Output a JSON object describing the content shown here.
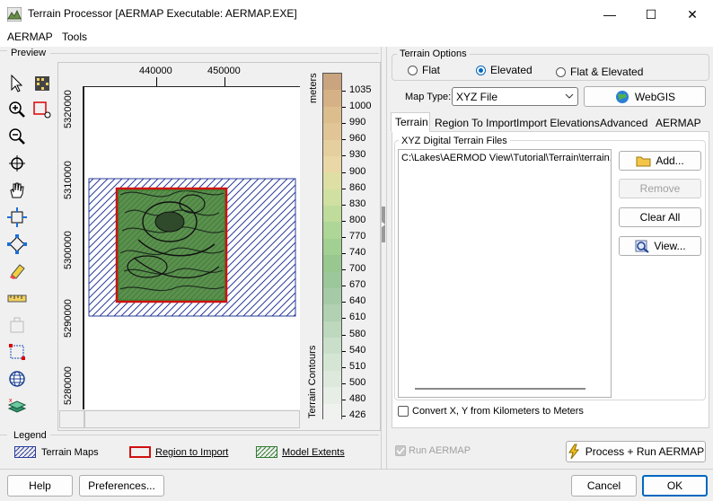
{
  "window": {
    "title": "Terrain Processor [AERMAP Executable: AERMAP.EXE]",
    "minimize_glyph": "—",
    "maximize_glyph": "☐",
    "close_glyph": "✕"
  },
  "menu": {
    "items": [
      "AERMAP",
      "Tools"
    ]
  },
  "preview": {
    "label": "Preview",
    "x_ticks": [
      "440000",
      "450000"
    ],
    "y_ticks": [
      "5320000",
      "5310000",
      "5300000",
      "5290000",
      "5280000"
    ],
    "colorbar_units": "meters",
    "colorbar_title": "Terrain Contours",
    "contour_levels": [
      "1035",
      "1000",
      "990",
      "960",
      "930",
      "900",
      "860",
      "830",
      "800",
      "770",
      "740",
      "700",
      "670",
      "640",
      "610",
      "580",
      "540",
      "510",
      "500",
      "480",
      "426"
    ],
    "contour_colors": [
      "#c9a47e",
      "#d6b186",
      "#dcbd8c",
      "#e2c596",
      "#e6cf9e",
      "#e9d7a6",
      "#dedfa2",
      "#d0e0a0",
      "#bfdc9b",
      "#aed696",
      "#a2d092",
      "#98c890",
      "#9cc79a",
      "#a5cba6",
      "#b1d1b2",
      "#bdd8bd",
      "#c9dfc9",
      "#d4e6d3",
      "#dee9dd",
      "#e7eee6",
      "#eff2ef"
    ]
  },
  "legend": {
    "label": "Legend",
    "items": [
      "Terrain Maps",
      "Region to Import",
      "Model Extents"
    ]
  },
  "terrain_options": {
    "label": "Terrain Options",
    "radios": [
      "Flat",
      "Elevated",
      "Flat & Elevated"
    ],
    "selected": "Elevated"
  },
  "map_type": {
    "label": "Map Type:",
    "value": "XYZ File",
    "webgis_label": "WebGIS"
  },
  "tabs": [
    "Terrain",
    "Region To Import",
    "Import Elevations",
    "Advanced",
    "AERMAP"
  ],
  "active_tab": "Terrain",
  "xyz_files": {
    "label": "XYZ Digital Terrain Files",
    "files": [
      "C:\\Lakes\\AERMOD View\\Tutorial\\Terrain\\terrain.xyz"
    ],
    "add_label": "Add...",
    "remove_label": "Remove",
    "clear_label": "Clear All",
    "view_label": "View..."
  },
  "convert_checkbox": {
    "label": "Convert X, Y from Kilometers to Meters",
    "checked": false
  },
  "run_aermap": {
    "label": "Run AERMAP",
    "checked": true
  },
  "process_run_label": "Process + Run AERMAP",
  "footer": {
    "help": "Help",
    "preferences": "Preferences...",
    "cancel": "Cancel",
    "ok": "OK"
  }
}
